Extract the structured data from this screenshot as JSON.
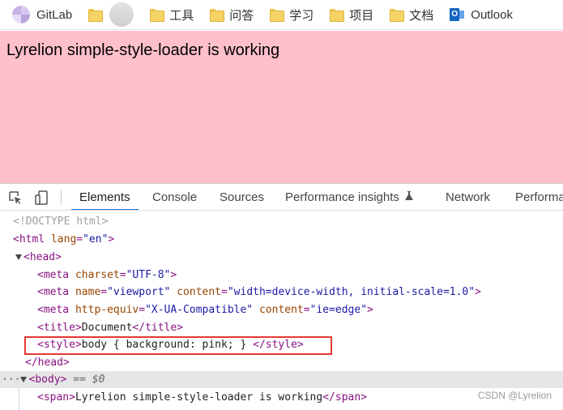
{
  "bookmarks": {
    "items": [
      {
        "label": "GitLab",
        "icon": "gitlab-icon"
      },
      {
        "label": "",
        "icon": "folder-icon"
      },
      {
        "label": "",
        "icon": "avatar-icon"
      },
      {
        "label": "工具",
        "icon": "folder-icon"
      },
      {
        "label": "问答",
        "icon": "folder-icon"
      },
      {
        "label": "学习",
        "icon": "folder-icon"
      },
      {
        "label": "项目",
        "icon": "folder-icon"
      },
      {
        "label": "文档",
        "icon": "folder-icon"
      },
      {
        "label": "Outlook",
        "icon": "outlook-icon"
      }
    ]
  },
  "page": {
    "text": "Lyrelion simple-style-loader is working",
    "background": "#ffc0cb"
  },
  "devtools": {
    "tabs": [
      "Elements",
      "Console",
      "Sources",
      "Performance insights",
      "Network",
      "Performa"
    ],
    "active_tab": "Elements",
    "tree": {
      "doctype": "<!DOCTYPE html>",
      "html_tag": "html",
      "lang_attr": "lang",
      "lang_val": "\"en\"",
      "head_tag": "head",
      "meta": "meta",
      "charset_attr": "charset",
      "charset_val": "\"UTF-8\"",
      "name_attr": "name",
      "name_val": "\"viewport\"",
      "content_attr": "content",
      "content_val_viewport": "\"width=device-width, initial-scale=1.0\"",
      "http_equiv_attr": "http-equiv",
      "http_equiv_val": "\"X-UA-Compatible\"",
      "content_val_compat": "\"ie=edge\"",
      "title_tag": "title",
      "title_text": "Document",
      "style_tag": "style",
      "style_text": "body { background: pink; } ",
      "body_tag": "body",
      "body_marker": " == $0",
      "span_tag": "span",
      "span_text": "Lyrelion simple-style-loader is working",
      "ellipsis": "···"
    }
  },
  "watermark": "CSDN @Lyrelion",
  "colors": {
    "tag": "#881280",
    "attr": "#994500",
    "value": "#1a1aa6",
    "highlight": "#e53935",
    "active_tab": "#1a73e8"
  }
}
